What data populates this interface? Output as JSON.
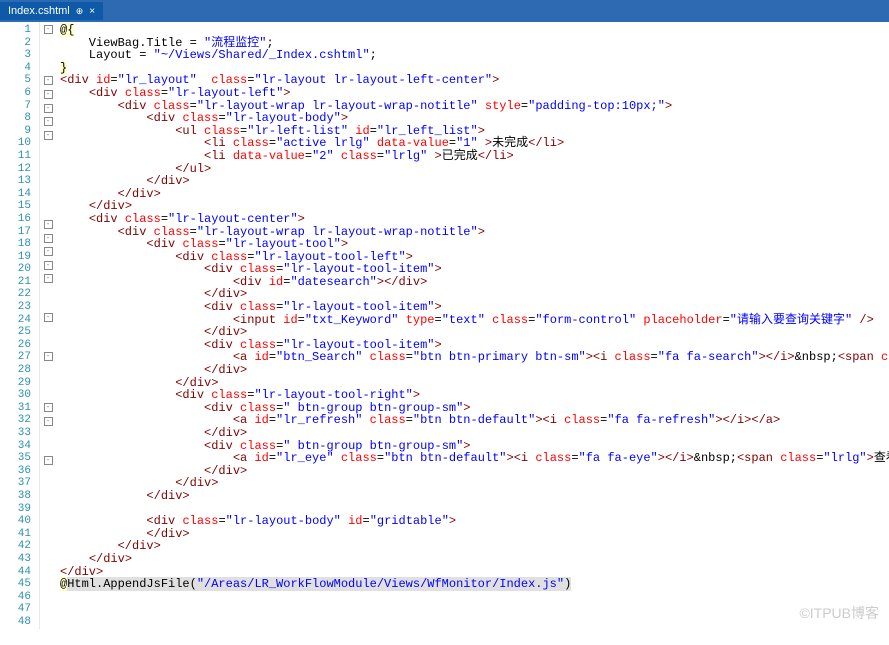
{
  "tab": {
    "title": "Index.cshtml",
    "close": "×"
  },
  "watermark": "©ITPUB博客",
  "lines": [
    {
      "n": 1,
      "f": "-",
      "html": "<span class='at'>@{</span>"
    },
    {
      "n": 2,
      "f": "",
      "html": "    ViewBag.Title = <span class='str'>\"流程监控\"</span>;"
    },
    {
      "n": 3,
      "f": "",
      "html": "    Layout = <span class='str'>\"~/Views/Shared/_Index.cshtml\"</span>;"
    },
    {
      "n": 4,
      "f": "",
      "html": "<span class='at'>}</span>"
    },
    {
      "n": 5,
      "f": "-",
      "html": "<span class='tag'>&lt;div</span> <span class='attr'>id</span>=<span class='str'>\"lr_layout\"</span>  <span class='attr'>class</span>=<span class='str'>\"lr-layout lr-layout-left-center\"</span><span class='tag'>&gt;</span>"
    },
    {
      "n": 6,
      "f": "-",
      "html": "    <span class='tag'>&lt;div</span> <span class='attr'>class</span>=<span class='str'>\"lr-layout-left\"</span><span class='tag'>&gt;</span>"
    },
    {
      "n": 7,
      "f": "-",
      "html": "        <span class='tag'>&lt;div</span> <span class='attr'>class</span>=<span class='str'>\"lr-layout-wrap lr-layout-wrap-notitle\"</span> <span class='attr'>style</span>=<span class='str'>\"padding-top:10px;\"</span><span class='tag'>&gt;</span>"
    },
    {
      "n": 8,
      "f": "-",
      "html": "            <span class='tag'>&lt;div</span> <span class='attr'>class</span>=<span class='str'>\"lr-layout-body\"</span><span class='tag'>&gt;</span>"
    },
    {
      "n": 9,
      "f": "-",
      "html": "                <span class='tag'>&lt;ul</span> <span class='attr'>class</span>=<span class='str'>\"lr-left-list\"</span> <span class='attr'>id</span>=<span class='str'>\"lr_left_list\"</span><span class='tag'>&gt;</span>"
    },
    {
      "n": 10,
      "f": "",
      "html": "                    <span class='tag'>&lt;li</span> <span class='attr'>class</span>=<span class='str'>\"active lrlg\"</span> <span class='attr'>data-value</span>=<span class='str'>\"1\"</span> <span class='tag'>&gt;</span>未完成<span class='tag'>&lt;/li&gt;</span>"
    },
    {
      "n": 11,
      "f": "",
      "html": "                    <span class='tag'>&lt;li</span> <span class='attr'>data-value</span>=<span class='str'>\"2\"</span> <span class='attr'>class</span>=<span class='str'>\"lrlg\"</span> <span class='tag'>&gt;</span>已完成<span class='tag'>&lt;/li&gt;</span>"
    },
    {
      "n": 12,
      "f": "",
      "html": "                <span class='tag'>&lt;/ul&gt;</span>"
    },
    {
      "n": 13,
      "f": "",
      "html": "            <span class='tag'>&lt;/div&gt;</span>"
    },
    {
      "n": 14,
      "f": "",
      "html": "        <span class='tag'>&lt;/div&gt;</span>"
    },
    {
      "n": 15,
      "f": "",
      "html": "    <span class='tag'>&lt;/div&gt;</span>"
    },
    {
      "n": 16,
      "f": "-",
      "html": "    <span class='tag'>&lt;div</span> <span class='attr'>class</span>=<span class='str'>\"lr-layout-center\"</span><span class='tag'>&gt;</span>"
    },
    {
      "n": 17,
      "f": "-",
      "html": "        <span class='tag'>&lt;div</span> <span class='attr'>class</span>=<span class='str'>\"lr-layout-wrap lr-layout-wrap-notitle\"</span><span class='tag'>&gt;</span>"
    },
    {
      "n": 18,
      "f": "-",
      "html": "            <span class='tag'>&lt;div</span> <span class='attr'>class</span>=<span class='str'>\"lr-layout-tool\"</span><span class='tag'>&gt;</span>"
    },
    {
      "n": 19,
      "f": "-",
      "html": "                <span class='tag'>&lt;div</span> <span class='attr'>class</span>=<span class='str'>\"lr-layout-tool-left\"</span><span class='tag'>&gt;</span>"
    },
    {
      "n": 20,
      "f": "-",
      "html": "                    <span class='tag'>&lt;div</span> <span class='attr'>class</span>=<span class='str'>\"lr-layout-tool-item\"</span><span class='tag'>&gt;</span>"
    },
    {
      "n": 21,
      "f": "",
      "html": "                        <span class='tag'>&lt;div</span> <span class='attr'>id</span>=<span class='str'>\"datesearch\"</span><span class='tag'>&gt;&lt;/div&gt;</span>"
    },
    {
      "n": 22,
      "f": "",
      "html": "                    <span class='tag'>&lt;/div&gt;</span>"
    },
    {
      "n": 23,
      "f": "-",
      "html": "                    <span class='tag'>&lt;div</span> <span class='attr'>class</span>=<span class='str'>\"lr-layout-tool-item\"</span><span class='tag'>&gt;</span>"
    },
    {
      "n": 24,
      "f": "",
      "html": "                        <span class='tag'>&lt;input</span> <span class='attr'>id</span>=<span class='str'>\"txt_Keyword\"</span> <span class='attr'>type</span>=<span class='str'>\"text\"</span> <span class='attr'>class</span>=<span class='str'>\"form-control\"</span> <span class='attr'>placeholder</span>=<span class='str'>\"请输入要查询关键字\"</span> <span class='tag'>/&gt;</span>"
    },
    {
      "n": 25,
      "f": "",
      "html": "                    <span class='tag'>&lt;/div&gt;</span>"
    },
    {
      "n": 26,
      "f": "-",
      "html": "                    <span class='tag'>&lt;div</span> <span class='attr'>class</span>=<span class='str'>\"lr-layout-tool-item\"</span><span class='tag'>&gt;</span>"
    },
    {
      "n": 27,
      "f": "",
      "html": "                        <span class='tag'>&lt;a</span> <span class='attr'>id</span>=<span class='str'>\"btn_Search\"</span> <span class='attr'>class</span>=<span class='str'>\"btn btn-primary btn-sm\"</span><span class='tag'>&gt;&lt;i</span> <span class='attr'>class</span>=<span class='str'>\"fa fa-search\"</span><span class='tag'>&gt;&lt;/i&gt;</span><span class='pl'>&amp;nbsp;</span><span class='tag'>&lt;span</span> <span class='attr'>class</span>=<span class='str'>\"lrlg\"</span><span class='tag'>&gt;</span>查询<span class='tag'>&lt;/span&gt;&lt;/a&gt;</span>"
    },
    {
      "n": 28,
      "f": "",
      "html": "                    <span class='tag'>&lt;/div&gt;</span>"
    },
    {
      "n": 29,
      "f": "",
      "html": "                <span class='tag'>&lt;/div&gt;</span>"
    },
    {
      "n": 30,
      "f": "-",
      "html": "                <span class='tag'>&lt;div</span> <span class='attr'>class</span>=<span class='str'>\"lr-layout-tool-right\"</span><span class='tag'>&gt;</span>"
    },
    {
      "n": 31,
      "f": "-",
      "html": "                    <span class='tag'>&lt;div</span> <span class='attr'>class</span>=<span class='str'>\" btn-group btn-group-sm\"</span><span class='tag'>&gt;</span>"
    },
    {
      "n": 32,
      "f": "",
      "html": "                        <span class='tag'>&lt;a</span> <span class='attr'>id</span>=<span class='str'>\"lr_refresh\"</span> <span class='attr'>class</span>=<span class='str'>\"btn btn-default\"</span><span class='tag'>&gt;&lt;i</span> <span class='attr'>class</span>=<span class='str'>\"fa fa-refresh\"</span><span class='tag'>&gt;&lt;/i&gt;&lt;/a&gt;</span>"
    },
    {
      "n": 33,
      "f": "",
      "html": "                    <span class='tag'>&lt;/div&gt;</span>"
    },
    {
      "n": 34,
      "f": "-",
      "html": "                    <span class='tag'>&lt;div</span> <span class='attr'>class</span>=<span class='str'>\" btn-group btn-group-sm\"</span><span class='tag'>&gt;</span>"
    },
    {
      "n": 35,
      "f": "",
      "html": "                        <span class='tag'>&lt;a</span> <span class='attr'>id</span>=<span class='str'>\"lr_eye\"</span> <span class='attr'>class</span>=<span class='str'>\"btn btn-default\"</span><span class='tag'>&gt;&lt;i</span> <span class='attr'>class</span>=<span class='str'>\"fa fa-eye\"</span><span class='tag'>&gt;&lt;/i&gt;</span><span class='pl'>&amp;nbsp;</span><span class='tag'>&lt;span</span> <span class='attr'>class</span>=<span class='str'>\"lrlg\"</span><span class='tag'>&gt;</span>查看进度<span class='tag'>&lt;/span&gt;&lt;/a&gt;</span>"
    },
    {
      "n": 36,
      "f": "",
      "html": "                    <span class='tag'>&lt;/div&gt;</span>"
    },
    {
      "n": 37,
      "f": "",
      "html": "                <span class='tag'>&lt;/div&gt;</span>"
    },
    {
      "n": 38,
      "f": "",
      "html": "            <span class='tag'>&lt;/div&gt;</span>"
    },
    {
      "n": 39,
      "f": "",
      "html": ""
    },
    {
      "n": 40,
      "f": "",
      "html": "            <span class='tag'>&lt;div</span> <span class='attr'>class</span>=<span class='str'>\"lr-layout-body\"</span> <span class='attr'>id</span>=<span class='str'>\"gridtable\"</span><span class='tag'>&gt;</span>"
    },
    {
      "n": 41,
      "f": "",
      "html": "            <span class='tag'>&lt;/div&gt;</span>"
    },
    {
      "n": 42,
      "f": "",
      "html": "        <span class='tag'>&lt;/div&gt;</span>"
    },
    {
      "n": 43,
      "f": "",
      "html": "    <span class='tag'>&lt;/div&gt;</span>"
    },
    {
      "n": 44,
      "f": "",
      "html": "<span class='tag'>&lt;/div&gt;</span>"
    },
    {
      "n": 45,
      "f": "",
      "html": "<span class='hl-y'>@</span><span class='hl-g'>Html.AppendJsFile(<span class='str'>\"/Areas/LR_WorkFlowModule/Views/WfMonitor/Index.js\"</span>)</span>"
    },
    {
      "n": 46,
      "f": "",
      "html": ""
    },
    {
      "n": 47,
      "f": "",
      "html": ""
    },
    {
      "n": 48,
      "f": "",
      "html": ""
    }
  ]
}
